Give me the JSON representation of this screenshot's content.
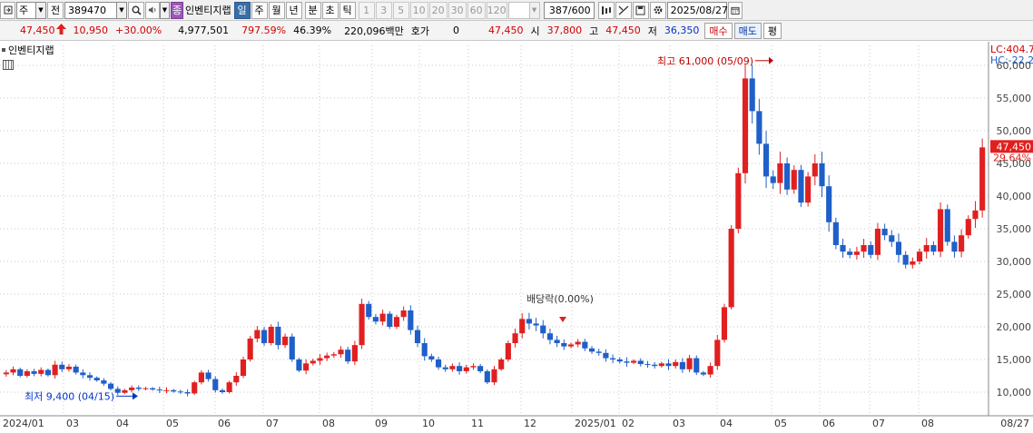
{
  "toolbar": {
    "type_label": "주",
    "prev_label": "전",
    "code": "389470",
    "stock_name": "인벤티지랩",
    "period_buttons": [
      "일",
      "주",
      "월",
      "년",
      "분",
      "초",
      "틱"
    ],
    "interval_buttons": [
      "1",
      "3",
      "5",
      "10",
      "20",
      "30",
      "60",
      "120"
    ],
    "count_value": "387",
    "count_total": "/600",
    "date_value": "2025/08/27"
  },
  "quote": {
    "price": "47,450",
    "change": "10,950",
    "change_rate": "+30.00%",
    "volume": "4,977,501",
    "volume_ratio": "797.59%",
    "turnover": "46.39%",
    "amount": "220,096백만",
    "hoga_label": "호가",
    "hoga_value": "0",
    "bid_value": "47,450",
    "open_label": "시",
    "open_value": "37,800",
    "high_label": "고",
    "high_value": "47,450",
    "low_label": "저",
    "low_value": "36,350",
    "buy_label": "매수",
    "sell_label": "매도",
    "eval_label": "평"
  },
  "legend": {
    "label": "인벤티지랩"
  },
  "colors": {
    "up": "#e02020",
    "down": "#1f5fc8",
    "grid": "#c8c8c8"
  },
  "chart_data": {
    "type": "candlestick",
    "x_ticks": [
      "2024/01",
      "03",
      "04",
      "05",
      "06",
      "07",
      "08",
      "09",
      "10",
      "11",
      "12",
      "2025/01",
      "02",
      "03",
      "04",
      "05",
      "06",
      "07",
      "08",
      "08/27"
    ],
    "y_ticks": [
      "60,000",
      "55,000",
      "50,000",
      "45,000",
      "40,000",
      "35,000",
      "30,000",
      "25,000",
      "20,000",
      "15,000",
      "10,000"
    ],
    "ylim": [
      8000,
      62500
    ],
    "annotations": {
      "high": "최고 61,000 (05/09)",
      "low": "최저 9,400 (04/15)",
      "dividend": "배당락(0.00%)"
    },
    "right_labels": {
      "lc": "LC:404.7",
      "hc": "HC:-22.2",
      "price": "47,450",
      "pct": "29.64%"
    },
    "series": [
      {
        "weeks": 15,
        "values": [
          13000,
          13500,
          12500,
          13200,
          12800,
          13400,
          12600,
          14200,
          13500,
          13900,
          13000,
          12600,
          12200,
          11800,
          11300
        ]
      },
      {
        "weeks": 16,
        "values": [
          10500,
          9900,
          10300,
          10700,
          10500,
          10600,
          10400,
          10300,
          10300,
          10100,
          10000,
          9800,
          11500,
          13000,
          12000,
          10300
        ]
      },
      {
        "weeks": 18,
        "values": [
          10000,
          11500,
          12500,
          15000,
          18200,
          19500,
          17500,
          20000,
          17200,
          18500,
          15000,
          13300,
          14400,
          14800,
          15200,
          15600,
          15800,
          16500
        ]
      },
      {
        "weeks": 18,
        "values": [
          14700,
          17200,
          23500,
          21500,
          20800,
          22000,
          20000,
          21500,
          22500,
          19500,
          17500,
          15500,
          15000,
          13800,
          13500,
          14000,
          13200,
          13800
        ]
      },
      {
        "weeks": 18,
        "values": [
          14000,
          13200,
          11500,
          13500,
          15000,
          17500,
          19000,
          21200,
          20500,
          20200,
          19000,
          18000,
          17500,
          17000,
          17300,
          17700,
          16700,
          16200
        ]
      },
      {
        "weeks": 18,
        "values": [
          16000,
          15200,
          15000,
          14700,
          14500,
          14800,
          14300,
          14200,
          14000,
          14400,
          14000,
          14600,
          13500,
          15200,
          13000,
          12700,
          14000,
          18000
        ]
      },
      {
        "weeks": 16,
        "values": [
          23000,
          35000,
          43500,
          58000,
          53000,
          48000,
          43000,
          42000,
          45000,
          41000,
          44000,
          39000,
          43000,
          45000,
          41500,
          36000
        ]
      },
      {
        "weeks": 18,
        "values": [
          32500,
          31500,
          31000,
          31500,
          32500,
          31000,
          35000,
          34000,
          33000,
          31000,
          29500,
          30000,
          31500,
          32500,
          31500,
          38000,
          33000,
          31500
        ]
      },
      {
        "weeks": 4,
        "values": [
          34000,
          36500,
          37800,
          47450
        ]
      }
    ]
  }
}
